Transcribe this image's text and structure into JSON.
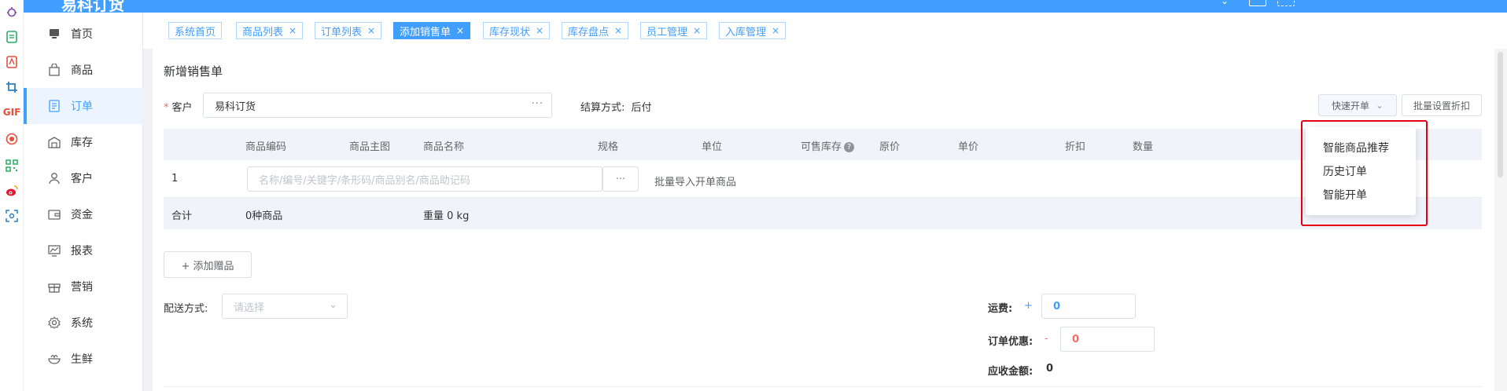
{
  "app": {
    "title": "易科订货",
    "accent": "#409eff"
  },
  "icon_strip": [
    "bug-icon",
    "document-icon",
    "pdf-icon",
    "crop-icon",
    "gif-icon",
    "record-icon",
    "qrcode-icon",
    "weibo-icon",
    "scan-icon"
  ],
  "icon_strip_gif": "GIF",
  "sidebar": {
    "items": [
      {
        "label": "首页",
        "icon": "monitor-icon"
      },
      {
        "label": "商品",
        "icon": "shopping-bag-icon"
      },
      {
        "label": "订单",
        "icon": "order-icon",
        "active": true
      },
      {
        "label": "库存",
        "icon": "warehouse-icon"
      },
      {
        "label": "客户",
        "icon": "user-icon"
      },
      {
        "label": "资金",
        "icon": "wallet-icon"
      },
      {
        "label": "报表",
        "icon": "chart-icon"
      },
      {
        "label": "营销",
        "icon": "gift-icon"
      },
      {
        "label": "系统",
        "icon": "gear-icon"
      },
      {
        "label": "生鲜",
        "icon": "fresh-icon"
      }
    ]
  },
  "tabs": [
    {
      "label": "系统首页",
      "closable": false
    },
    {
      "label": "商品列表",
      "closable": true
    },
    {
      "label": "订单列表",
      "closable": true
    },
    {
      "label": "添加销售单",
      "closable": true,
      "active": true
    },
    {
      "label": "库存现状",
      "closable": true
    },
    {
      "label": "库存盘点",
      "closable": true
    },
    {
      "label": "员工管理",
      "closable": true
    },
    {
      "label": "入库管理",
      "closable": true
    }
  ],
  "tab_close_glyph": "×",
  "form": {
    "page_title": "新增销售单",
    "customer_required_mark": "*",
    "customer_label": "客户",
    "customer_value": "易科订货",
    "more_glyph": "···",
    "settlement_label": "结算方式:",
    "settlement_value": "后付",
    "quick_order_label": "快速开单",
    "batch_discount_label": "批量设置折扣"
  },
  "table": {
    "headers": [
      "商品编码",
      "商品主图",
      "商品名称",
      "规格",
      "单位",
      "可售库存",
      "原价",
      "单价",
      "折扣",
      "数量"
    ],
    "help_glyph": "?",
    "row_index": "1",
    "search_placeholder": "名称/编号/关键字/条形码/商品别名/商品助记码",
    "batch_import_label": "批量导入开单商品",
    "summary_label": "合计",
    "summary_count": "0种商品",
    "summary_weight": "重量 0 kg"
  },
  "dropdown": {
    "items": [
      "智能商品推荐",
      "历史订单",
      "智能开单"
    ]
  },
  "add_gift_label": "+ 添加赠品",
  "delivery": {
    "label": "配送方式:",
    "placeholder": "请选择"
  },
  "totals": {
    "freight_label": "运费:",
    "freight_sign": "+",
    "freight_value": "0",
    "discount_label": "订单优惠:",
    "discount_sign": "-",
    "discount_value": "0",
    "receivable_label": "应收金额:",
    "receivable_value": "0"
  },
  "colors": {
    "danger": "#f56c6c",
    "highlight_frame": "#e60012"
  }
}
